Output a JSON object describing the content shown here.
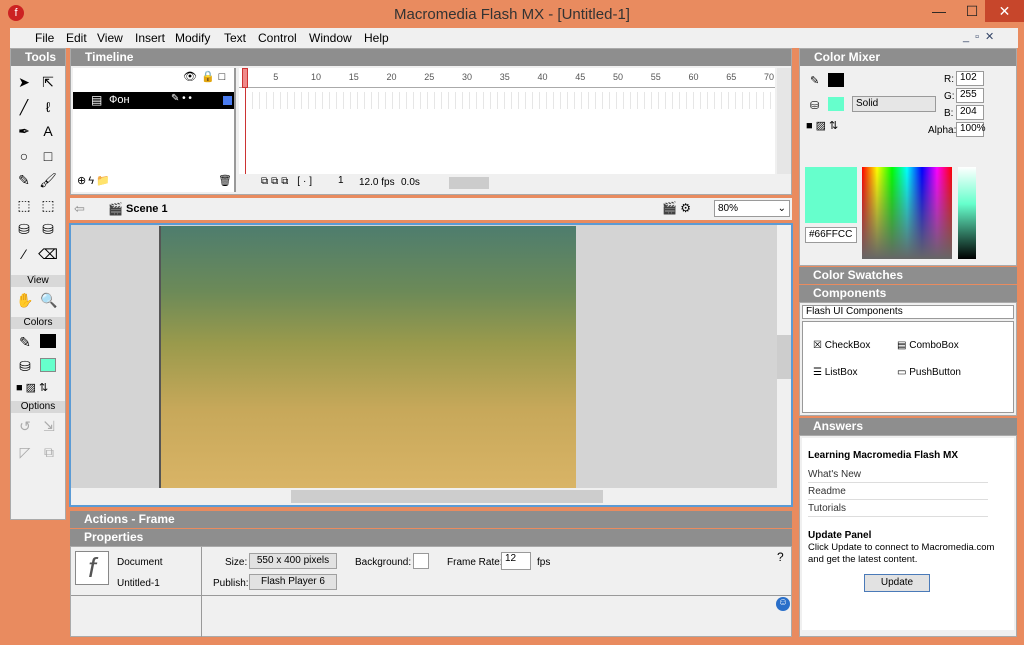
{
  "window": {
    "title": "Macromedia Flash MX - [Untitled-1]",
    "min": "—",
    "max": "☐",
    "close": "✕"
  },
  "menu": [
    "File",
    "Edit",
    "View",
    "Insert",
    "Modify",
    "Text",
    "Control",
    "Window",
    "Help"
  ],
  "tools": {
    "title": "Tools",
    "view": "View",
    "colors": "Colors",
    "options": "Options",
    "icons": [
      "arrow-icon",
      "subselect-icon",
      "line-icon",
      "lasso-icon",
      "pen-icon",
      "text-icon",
      "oval-icon",
      "rectangle-icon",
      "pencil-icon",
      "brush-icon",
      "free-transform-icon",
      "fill-transform-icon",
      "ink-bottle-icon",
      "paint-bucket-icon",
      "eyedropper-icon",
      "eraser-icon"
    ],
    "glyphs": [
      "➤",
      "⇱",
      "╱",
      "ℓ",
      "✒",
      "A",
      "○",
      "□",
      "✎",
      "🖌",
      "⬚",
      "⬚",
      "⛁",
      "⛁",
      "⁄",
      "⌫"
    ]
  },
  "timeline": {
    "title": "Timeline",
    "layer": "Фон",
    "frame": "1",
    "fps": "12.0 fps",
    "time": "0.0s",
    "ticks": [
      "1",
      "5",
      "10",
      "15",
      "20",
      "25",
      "30",
      "35",
      "40",
      "45",
      "50",
      "55",
      "60",
      "65",
      "70"
    ]
  },
  "scene": {
    "label": "Scene 1",
    "zoom": "80%"
  },
  "actions": {
    "title": "Actions - Frame"
  },
  "properties": {
    "title": "Properties",
    "type": "Document",
    "name": "Untitled-1",
    "size_label": "Size:",
    "size": "550 x 400 pixels",
    "publish_label": "Publish:",
    "publish": "Flash Player 6",
    "bg_label": "Background:",
    "rate_label": "Frame Rate:",
    "rate": "12",
    "fps": "fps"
  },
  "mixer": {
    "title": "Color Mixer",
    "fill_type": "Solid",
    "r": "102",
    "g": "255",
    "b": "204",
    "alpha": "100%",
    "hex": "#66FFCC",
    "r_label": "R:",
    "g_label": "G:",
    "b_label": "B:",
    "alpha_label": "Alpha:"
  },
  "swatches": {
    "title": "Color Swatches"
  },
  "components": {
    "title": "Components",
    "set": "Flash UI Components",
    "items": [
      "CheckBox",
      "ComboBox",
      "ListBox",
      "PushButton"
    ]
  },
  "answers": {
    "title": "Answers",
    "heading": "Learning Macromedia Flash MX",
    "links": [
      "What's New",
      "Readme",
      "Tutorials"
    ],
    "update_title": "Update Panel",
    "update_text": "Click Update to connect to Macromedia.com and get the latest content.",
    "update_button": "Update"
  },
  "colors": {
    "accent": "#e98b5f",
    "fill": "#66FFCC",
    "stroke": "#000000"
  }
}
